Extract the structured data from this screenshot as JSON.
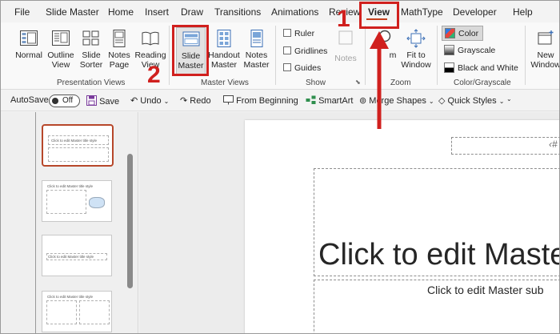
{
  "menu": {
    "tabs": [
      "File",
      "Slide Master",
      "Home",
      "Insert",
      "Draw",
      "Transitions",
      "Animations",
      "Review",
      "View",
      "MathType",
      "Developer",
      "Help"
    ],
    "active": "View"
  },
  "ribbon": {
    "presentation_views": {
      "label": "Presentation Views",
      "buttons": [
        {
          "l1": "Normal",
          "l2": ""
        },
        {
          "l1": "Outline",
          "l2": "View"
        },
        {
          "l1": "Slide",
          "l2": "Sorter"
        },
        {
          "l1": "Notes",
          "l2": "Page"
        },
        {
          "l1": "Reading",
          "l2": "View"
        }
      ]
    },
    "master_views": {
      "label": "Master Views",
      "buttons": [
        {
          "l1": "Slide",
          "l2": "Master"
        },
        {
          "l1": "Handout",
          "l2": "Master"
        },
        {
          "l1": "Notes",
          "l2": "Master"
        }
      ]
    },
    "show": {
      "label": "Show",
      "checkboxes": [
        "Ruler",
        "Gridlines",
        "Guides"
      ],
      "notes_label": "Notes"
    },
    "zoom": {
      "label": "Zoom",
      "zoom_button_partial": "m",
      "fit": {
        "l1": "Fit to",
        "l2": "Window"
      }
    },
    "color_grayscale": {
      "label": "Color/Grayscale",
      "items": [
        "Color",
        "Grayscale",
        "Black and White"
      ]
    },
    "window": {
      "l1": "New",
      "l2": "Window"
    }
  },
  "qat": {
    "autosave": "AutoSave",
    "toggle_state": "Off",
    "save": "Save",
    "undo": "Undo",
    "redo": "Redo",
    "from_beginning": "From Beginning",
    "smartart": "SmartArt",
    "merge_shapes": "Merge Shapes",
    "quick_styles": "Quick Styles"
  },
  "thumbnails": {
    "master_text": "Click to edit Master title style",
    "layout_text": "Click to edit Master title style"
  },
  "slide": {
    "title": "Click to edit Maste",
    "subtitle": "Click to edit Master sub"
  },
  "annotations": {
    "step1": "1",
    "step2": "2"
  },
  "colors": {
    "accent": "#c43e1c",
    "annotation": "#d0201e"
  }
}
